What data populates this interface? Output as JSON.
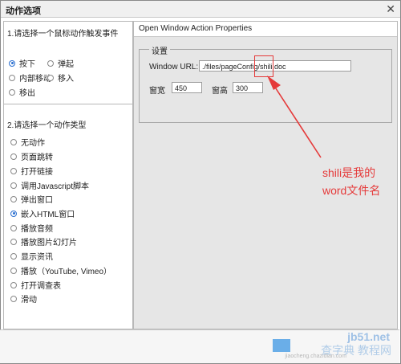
{
  "window": {
    "title": "动作选项",
    "close_glyph": "✕"
  },
  "left": {
    "section1": {
      "header": "1.请选择一个鼠标动作触发事件",
      "options": [
        {
          "label": "按下",
          "checked": true
        },
        {
          "label": "弹起",
          "checked": false
        },
        {
          "label": "内部移动",
          "checked": false
        },
        {
          "label": "移入",
          "checked": false
        },
        {
          "label": "移出",
          "checked": false
        }
      ]
    },
    "section2": {
      "header": "2.请选择一个动作类型",
      "options": [
        {
          "label": "无动作",
          "checked": false
        },
        {
          "label": "页面跳转",
          "checked": false
        },
        {
          "label": "打开链接",
          "checked": false
        },
        {
          "label": "调用Javascript脚本",
          "checked": false
        },
        {
          "label": "弹出窗口",
          "checked": false
        },
        {
          "label": "嵌入HTML窗口",
          "checked": true
        },
        {
          "label": "播放音频",
          "checked": false
        },
        {
          "label": "播放图片幻灯片",
          "checked": false
        },
        {
          "label": "显示资讯",
          "checked": false
        },
        {
          "label": "播放（YouTube, Vimeo）",
          "checked": false
        },
        {
          "label": "打开调查表",
          "checked": false
        },
        {
          "label": "滑动",
          "checked": false
        }
      ]
    }
  },
  "right": {
    "title": "Open Window Action Properties",
    "group_label": "设置",
    "url_label": "Window URL:",
    "url_value": "./files/pageConfig/shili.doc",
    "width_label": "窗宽",
    "width_value": "450",
    "height_label": "窗高",
    "height_value": "300"
  },
  "annotation": {
    "line1": "shili是我的",
    "line2": "word文件名"
  },
  "watermark": {
    "site": "jb51.net",
    "brand": "查字典 教程网",
    "url": "jiaocheng.chazidian.com"
  },
  "colors": {
    "accent": "#2a6fd0",
    "annotation": "#e53a3a"
  }
}
